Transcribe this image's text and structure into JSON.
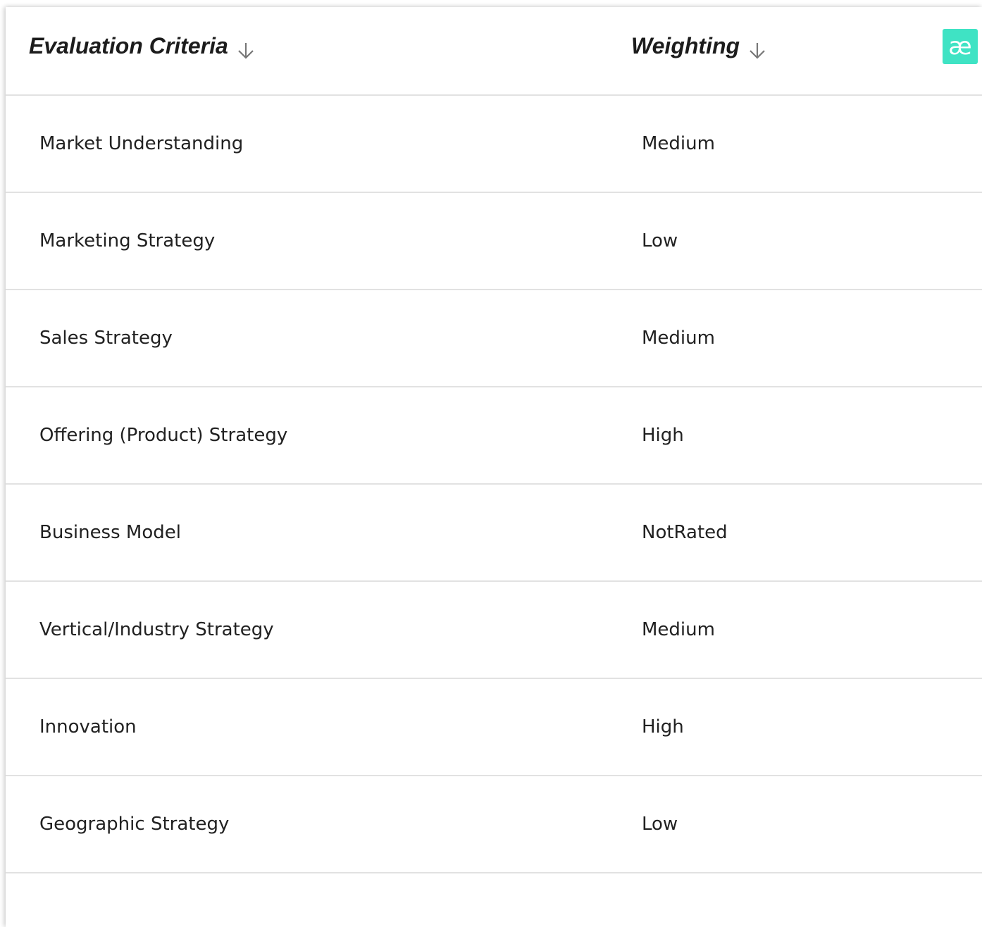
{
  "table": {
    "columns": {
      "criteria": "Evaluation Criteria",
      "weighting": "Weighting"
    },
    "sort_icon": "arrow-down-icon",
    "rows": [
      {
        "criteria": "Market Understanding",
        "weighting": "Medium"
      },
      {
        "criteria": "Marketing Strategy",
        "weighting": "Low"
      },
      {
        "criteria": "Sales Strategy",
        "weighting": "Medium"
      },
      {
        "criteria": "Offering (Product) Strategy",
        "weighting": "High"
      },
      {
        "criteria": "Business Model",
        "weighting": "NotRated"
      },
      {
        "criteria": "Vertical/Industry Strategy",
        "weighting": "Medium"
      },
      {
        "criteria": "Innovation",
        "weighting": "High"
      },
      {
        "criteria": "Geographic Strategy",
        "weighting": "Low"
      }
    ]
  },
  "brand_badge": {
    "glyph": "æ",
    "icon": "ae-logo-icon",
    "color": "#3fe3c4"
  },
  "colors": {
    "divider": "#e2e2e2",
    "text": "#212121",
    "sort_icon": "#777777"
  }
}
